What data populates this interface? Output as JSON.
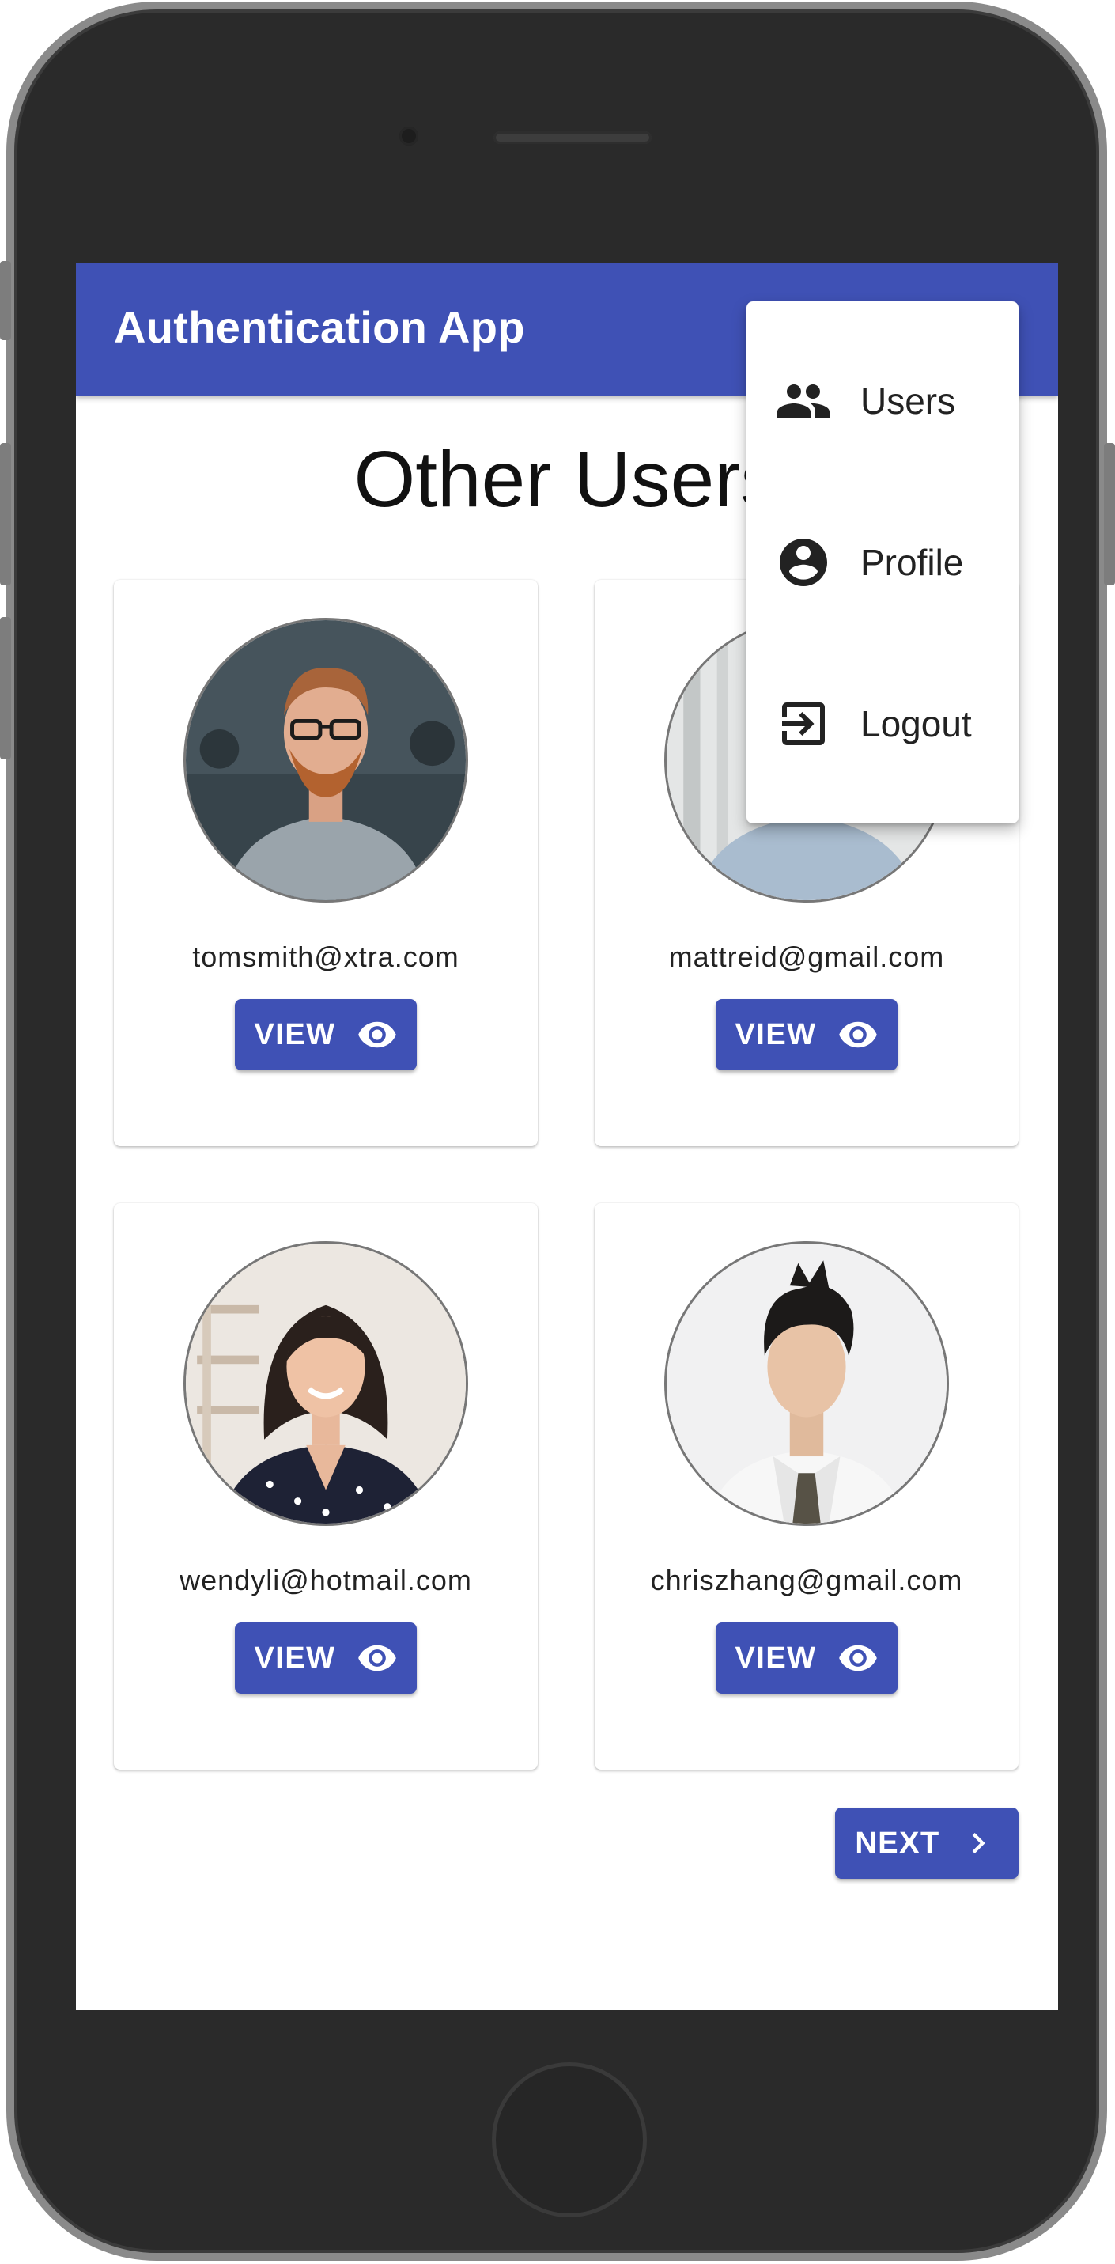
{
  "app": {
    "title": "Authentication App"
  },
  "page": {
    "title": "Other Users"
  },
  "menu": {
    "items": [
      {
        "label": "Users",
        "icon": "group-icon"
      },
      {
        "label": "Profile",
        "icon": "account-circle-icon"
      },
      {
        "label": "Logout",
        "icon": "exit-to-app-icon"
      }
    ]
  },
  "users": [
    {
      "email": "tomsmith@xtra.com",
      "view_label": "VIEW"
    },
    {
      "email": "mattreid@gmail.com",
      "view_label": "VIEW"
    },
    {
      "email": "wendyli@hotmail.com",
      "view_label": "VIEW"
    },
    {
      "email": "chriszhang@gmail.com",
      "view_label": "VIEW"
    }
  ],
  "pagination": {
    "next_label": "NEXT"
  },
  "colors": {
    "primary": "#3f51b5",
    "device_body": "#2a2a2a",
    "on_primary": "#ffffff"
  }
}
